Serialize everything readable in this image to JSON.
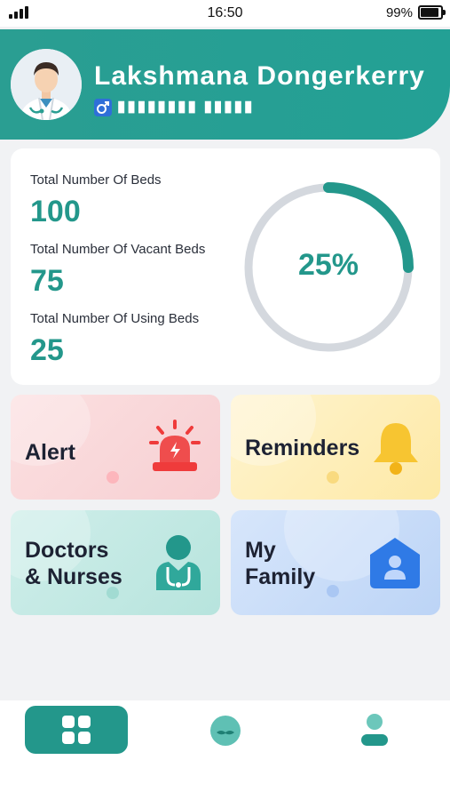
{
  "status_bar": {
    "time": "16:50",
    "battery": "99%"
  },
  "user": {
    "name": "Lakshmana Dongerkerry",
    "id_masked": "▮▮▮▮▮▮▮▮ ▮▮▮▮▮"
  },
  "beds": {
    "total_label": "Total Number Of Beds",
    "total_value": "100",
    "vacant_label": "Total Number Of Vacant Beds",
    "vacant_value": "75",
    "using_label": "Total Number Of Using Beds",
    "using_value": "25",
    "usage_percent": "25%",
    "usage_fraction": 0.25
  },
  "tiles": {
    "alert": "Alert",
    "reminders": "Reminders",
    "doctors_line1": "Doctors",
    "doctors_line2": "& Nurses",
    "family_line1": "My",
    "family_line2": "Family"
  },
  "colors": {
    "accent": "#23978b",
    "alert_red": "#ef3b3b",
    "bell_yellow": "#f7c531",
    "family_blue": "#2f7ae6",
    "ring_track": "#d4d8de"
  },
  "icons": {
    "alert": "siren-icon",
    "reminders": "bell-icon",
    "doctors": "doctor-icon",
    "family": "house-person-icon",
    "nav_home": "grid-icon",
    "nav_doctor": "doctor-head-icon",
    "nav_profile": "person-icon"
  }
}
